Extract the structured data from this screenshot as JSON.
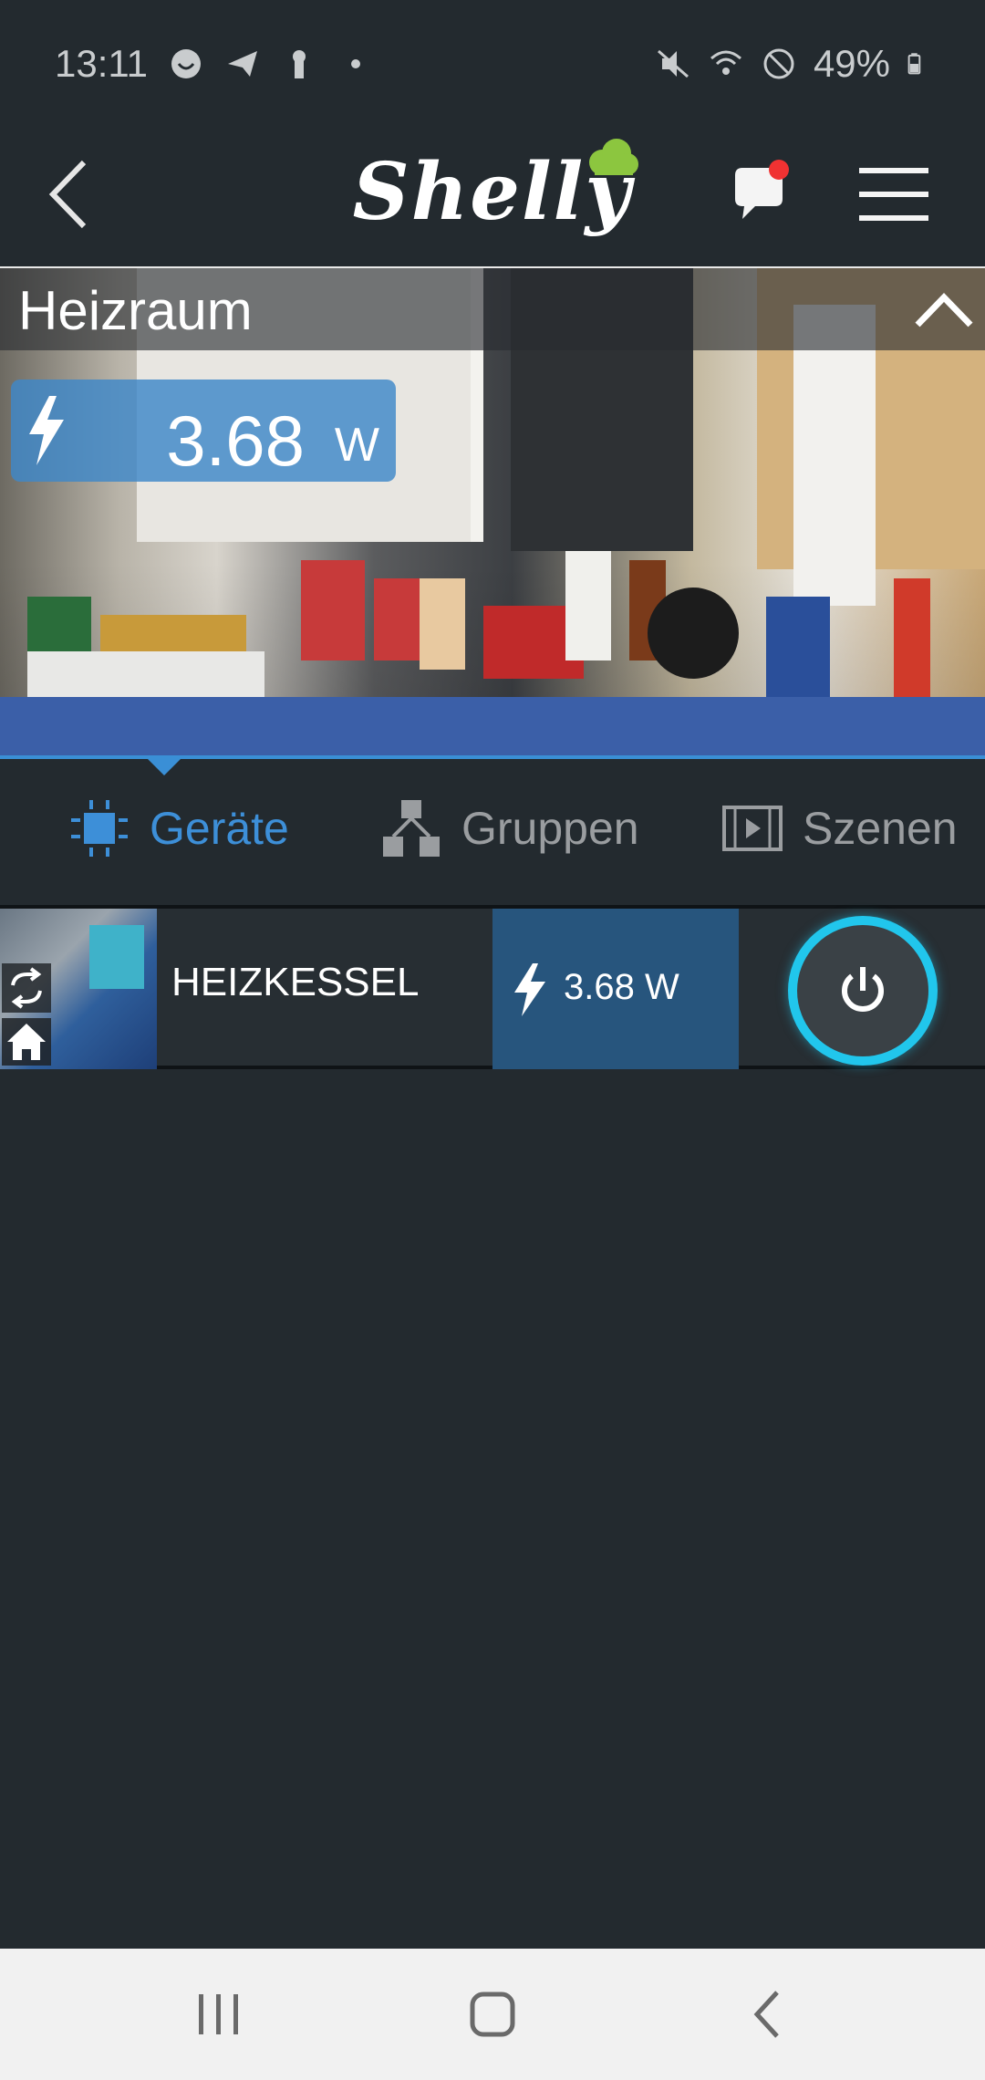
{
  "status_bar": {
    "time": "13:11",
    "battery": "49%",
    "left_icons": [
      "face-icon",
      "send-icon",
      "keyhole-icon",
      "dot-icon"
    ],
    "right_icons": [
      "mute-icon",
      "wifi-icon",
      "no-disturb-icon",
      "battery-icon"
    ]
  },
  "header": {
    "logo_text": "Shelly",
    "notification_dot_color": "#f03232"
  },
  "room": {
    "title": "Heizraum",
    "power_value": "3.68",
    "power_unit": "W"
  },
  "tabs": [
    {
      "label": "Geräte",
      "active": true
    },
    {
      "label": "Gruppen",
      "active": false
    },
    {
      "label": "Szenen",
      "active": false
    }
  ],
  "devices": [
    {
      "name": "HEIZKESSEL",
      "power": "3.68 W",
      "state": "on"
    }
  ],
  "colors": {
    "background": "#232a2f",
    "accent": "#3d8fd8",
    "toggle_ring": "#21c6ec",
    "logo_cloud": "#8cc63f"
  }
}
